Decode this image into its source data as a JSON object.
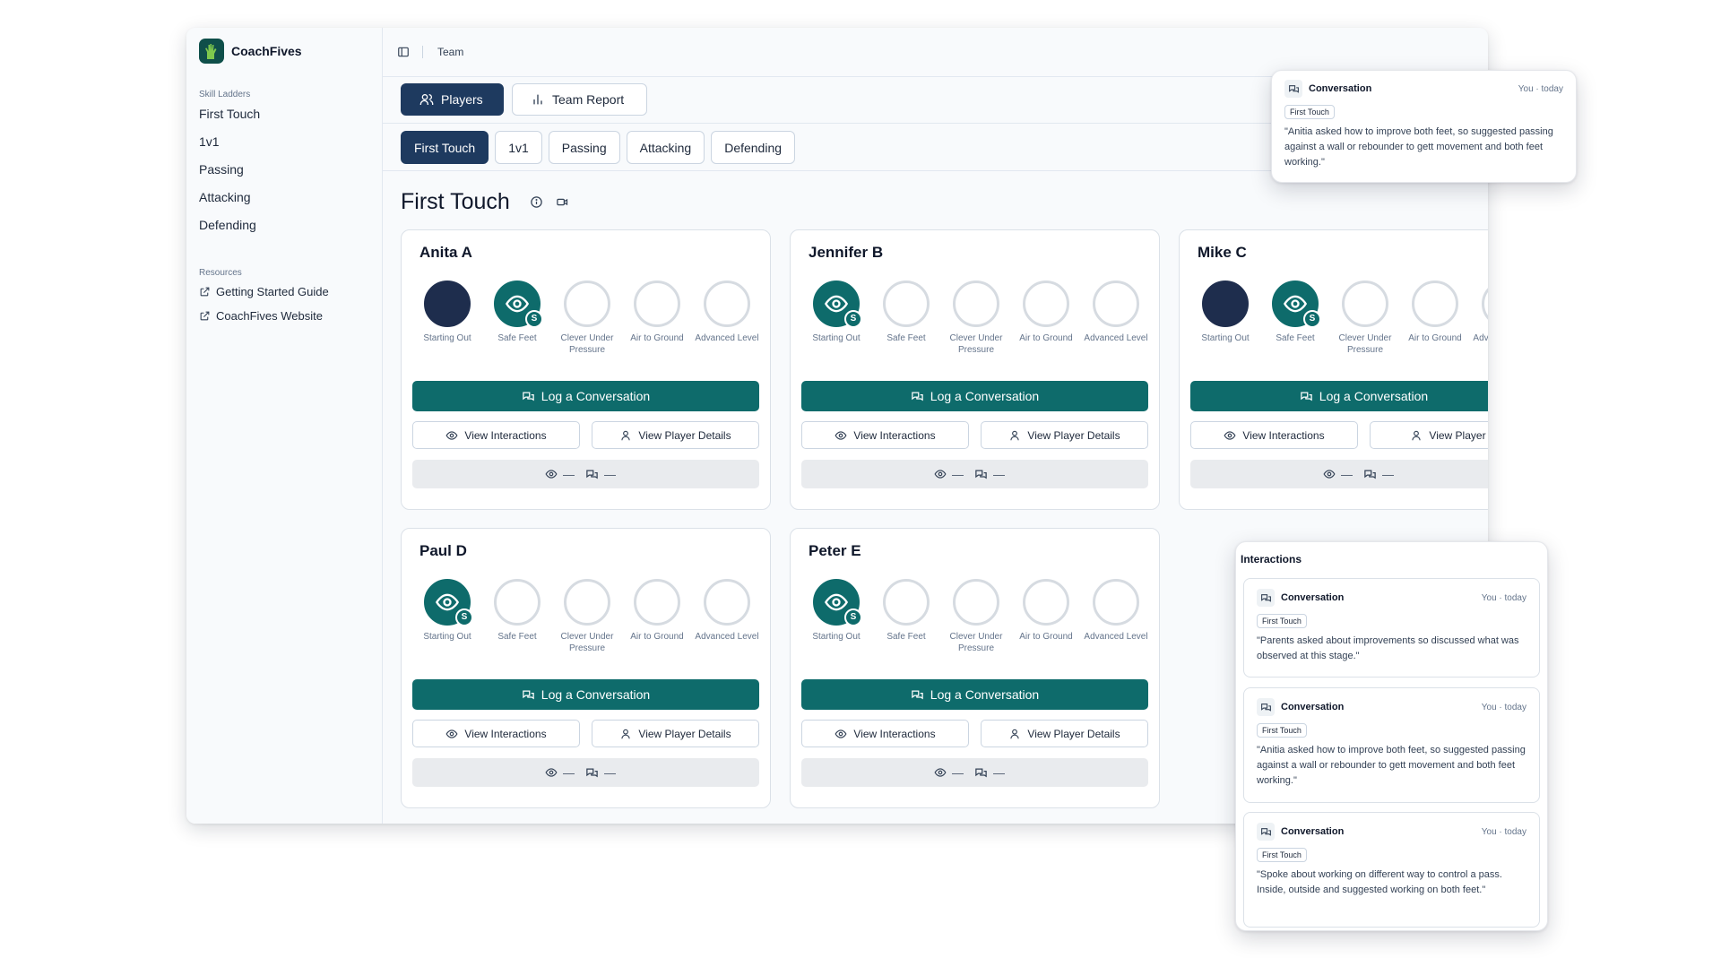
{
  "brand": {
    "name": "CoachFives"
  },
  "sidebar": {
    "section_label": "Skill Ladders",
    "items": [
      {
        "label": "First Touch"
      },
      {
        "label": "1v1"
      },
      {
        "label": "Passing"
      },
      {
        "label": "Attacking"
      },
      {
        "label": "Defending"
      }
    ],
    "resources_label": "Resources",
    "resources": [
      {
        "label": "Getting Started Guide"
      },
      {
        "label": "CoachFives Website"
      }
    ]
  },
  "topbar": {
    "breadcrumb": "Team"
  },
  "main_tabs": [
    {
      "label": "Players",
      "active": true
    },
    {
      "label": "Team Report",
      "active": false
    }
  ],
  "skill_tabs": [
    {
      "label": "First Touch",
      "active": true
    },
    {
      "label": "1v1",
      "active": false
    },
    {
      "label": "Passing",
      "active": false
    },
    {
      "label": "Attacking",
      "active": false
    },
    {
      "label": "Defending",
      "active": false
    }
  ],
  "page_title": "First Touch",
  "levels": [
    "Starting Out",
    "Safe Feet",
    "Clever Under Pressure",
    "Air to Ground",
    "Advanced Level"
  ],
  "current_badge": "S",
  "card_actions": {
    "log": "Log a Conversation",
    "view_interactions": "View Interactions",
    "view_details": "View Player Details",
    "view_details_truncated": "View Player D",
    "stat_placeholder": "—"
  },
  "players": [
    {
      "name": "Anita A",
      "levels": [
        "done",
        "current",
        "empty",
        "empty",
        "empty"
      ]
    },
    {
      "name": "Jennifer B",
      "levels": [
        "current",
        "empty",
        "empty",
        "empty",
        "empty"
      ]
    },
    {
      "name": "Mike C",
      "levels": [
        "done",
        "current",
        "empty",
        "empty",
        "empty"
      ]
    },
    {
      "name": "Paul D",
      "levels": [
        "current",
        "empty",
        "empty",
        "empty",
        "empty"
      ]
    },
    {
      "name": "Peter E",
      "levels": [
        "current",
        "empty",
        "empty",
        "empty",
        "empty"
      ]
    }
  ],
  "conversation_popup": {
    "title": "Conversation",
    "meta": "You · today",
    "tag": "First Touch",
    "text": "\"Anitia asked how to improve both feet, so suggested passing against a wall or rebounder to gett movement and both feet working.\""
  },
  "interactions_panel": {
    "title": "Interactions",
    "items": [
      {
        "title": "Conversation",
        "meta": "You · today",
        "tag": "First Touch",
        "text": "\"Parents asked about improvements so discussed what was observed at this stage.\""
      },
      {
        "title": "Conversation",
        "meta": "You · today",
        "tag": "First Touch",
        "text": "\"Anitia asked how to improve both feet, so suggested passing against a wall or rebounder to gett movement and both feet working.\""
      },
      {
        "title": "Conversation",
        "meta": "You · today",
        "tag": "First Touch",
        "text": "\"Spoke about working on different way to control a pass. Inside, outside and suggested working on both feet.\""
      }
    ]
  },
  "colors": {
    "primary_navy": "#1e3a5f",
    "teal": "#0e6b6b",
    "completed": "#1e2d4d"
  }
}
